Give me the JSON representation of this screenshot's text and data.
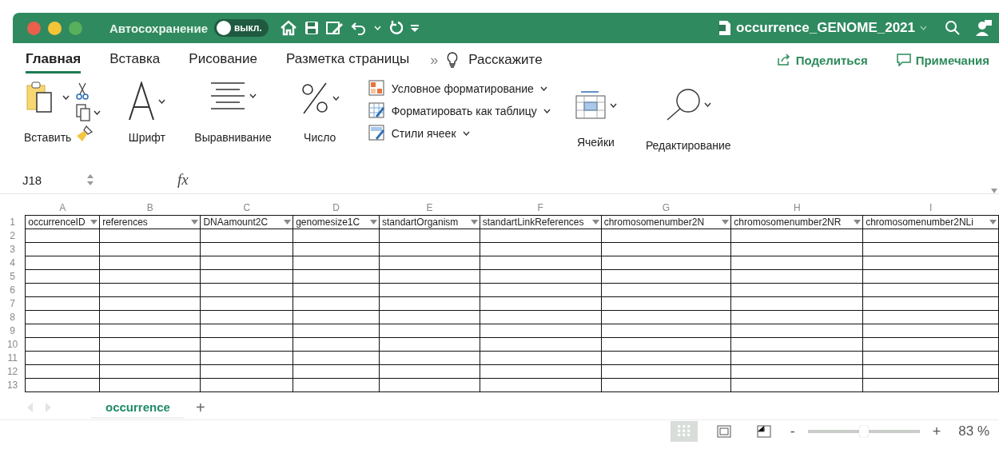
{
  "title_bar": {
    "autosave_label": "Автосохранение",
    "autosave": {
      "label": "выкл.",
      "on": false
    },
    "document_title": "occurrence_GENOME_2021"
  },
  "ribbon_tabs": [
    {
      "label": "Главная",
      "selected": true
    },
    {
      "label": "Вставка",
      "selected": false
    },
    {
      "label": "Рисование",
      "selected": false
    },
    {
      "label": "Разметка страницы",
      "selected": false
    }
  ],
  "ribbon_overflow": "»",
  "tell_me": "Расскажите",
  "share": "Поделиться",
  "comments": "Примечания",
  "ribbon": {
    "paste": "Вставить",
    "font": "Шрифт",
    "alignment": "Выравнивание",
    "number": "Число",
    "styles": [
      {
        "kind": "conditional",
        "label": "Условное форматирование"
      },
      {
        "kind": "table",
        "label": "Форматировать как таблицу"
      },
      {
        "kind": "cellstyles",
        "label": "Стили ячеек"
      }
    ],
    "cells": "Ячейки",
    "editing": "Редактирование"
  },
  "formula_bar": {
    "name_box": "J18",
    "fx": "fx"
  },
  "sheet": {
    "columns": [
      {
        "letter": "A",
        "header": "occurrenceID"
      },
      {
        "letter": "B",
        "header": "references"
      },
      {
        "letter": "C",
        "header": "DNAamount2C"
      },
      {
        "letter": "D",
        "header": "genomesize1C"
      },
      {
        "letter": "E",
        "header": "standartOrganism"
      },
      {
        "letter": "F",
        "header": "standartLinkReferences"
      },
      {
        "letter": "G",
        "header": "chromosomenumber2N"
      },
      {
        "letter": "H",
        "header": "chromosomenumber2NR"
      },
      {
        "letter": "I",
        "header": "chromosomenumber2NLi"
      }
    ],
    "row_numbers": [
      "1",
      "2",
      "3",
      "4",
      "5",
      "6",
      "7",
      "8",
      "9",
      "10",
      "11",
      "12",
      "13"
    ]
  },
  "sheet_tabs": [
    {
      "label": "occurrence",
      "selected": true
    }
  ],
  "add_sheet": "+",
  "status_bar": {
    "views": [
      {
        "kind": "normal",
        "selected": true
      },
      {
        "kind": "page",
        "selected": false
      },
      {
        "kind": "break",
        "selected": false
      }
    ],
    "zoom_minus": "-",
    "zoom_plus": "+",
    "zoom": {
      "level": 0.5
    },
    "zoom_text": "83 %"
  }
}
